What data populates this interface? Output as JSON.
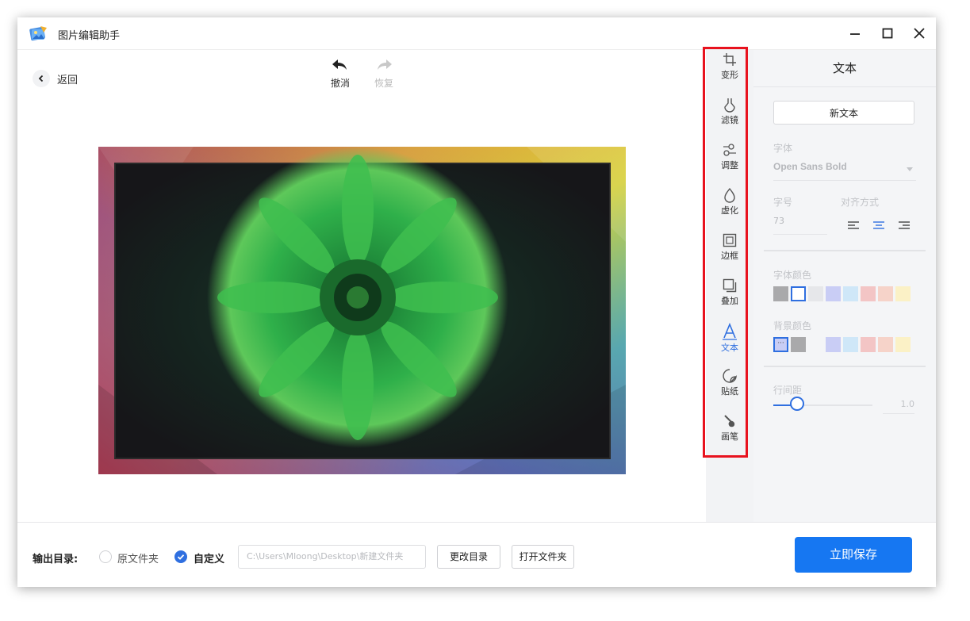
{
  "window": {
    "title": "图片编辑助手"
  },
  "toolbar": {
    "back_label": "返回",
    "undo_label": "撤消",
    "redo_label": "恢复"
  },
  "tools": [
    {
      "label": "变形",
      "icon": "crop-icon"
    },
    {
      "label": "滤镜",
      "icon": "flask-icon"
    },
    {
      "label": "调整",
      "icon": "adjust-icon"
    },
    {
      "label": "虚化",
      "icon": "drop-icon"
    },
    {
      "label": "边框",
      "icon": "frame-icon"
    },
    {
      "label": "叠加",
      "icon": "overlay-icon"
    },
    {
      "label": "文本",
      "icon": "text-icon",
      "active": true
    },
    {
      "label": "贴纸",
      "icon": "sticker-icon"
    },
    {
      "label": "画笔",
      "icon": "brush-icon"
    }
  ],
  "text_panel": {
    "title": "文本",
    "new_text_button": "新文本",
    "font_label": "字体",
    "font_value": "Open Sans Bold",
    "size_label": "字号",
    "size_value": "73",
    "align_label": "对齐方式",
    "selected_alignment": "center",
    "font_color_label": "字体颜色",
    "font_colors": [
      "#a9a9ab",
      "#ffffff",
      "#e6e7ea",
      "#c9cdf5",
      "#cfe7f8",
      "#f3c5c5",
      "#f6d3c9",
      "#fbf1c6"
    ],
    "selected_font_color": "#ffffff",
    "bg_color_label": "背景颜色",
    "bg_colors": [
      "#c9cdf5",
      "#a9a9ab",
      "#f4f5f7",
      "#c9cdf5",
      "#cfe7f8",
      "#f3c5c5",
      "#f6d3c9",
      "#fbf1c6"
    ],
    "line_spacing_label": "行间距",
    "line_spacing_value": "1.0"
  },
  "footer": {
    "output_label": "输出目录:",
    "option_original": "原文件夹",
    "option_custom": "自定义",
    "selected_option": "custom",
    "path": "C:\\Users\\Mloong\\Desktop\\新建文件夹",
    "change_dir_button": "更改目录",
    "open_folder_button": "打开文件夹",
    "save_button": "立即保存"
  },
  "colors": {
    "accent": "#1677f2",
    "highlight_border": "#e8121e"
  }
}
